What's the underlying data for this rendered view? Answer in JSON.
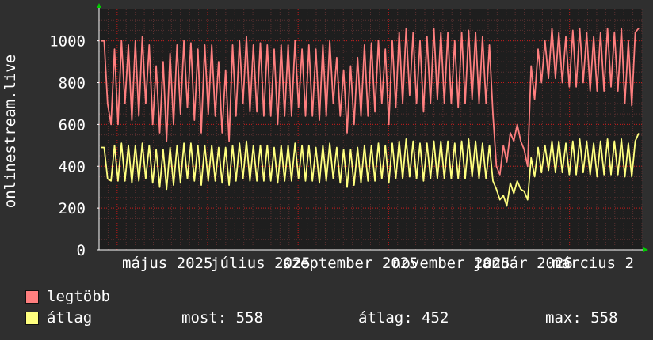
{
  "chart_data": {
    "type": "line",
    "ylabel": "onlinestream.live",
    "ylim": [
      0,
      1150
    ],
    "yticks": [
      0,
      200,
      400,
      600,
      800,
      1000
    ],
    "xtick_labels": [
      "május 2025",
      "július 2025",
      "szeptember 2025",
      "november 2025",
      "január 2026",
      "március 2"
    ],
    "grid": true,
    "series": [
      {
        "name": "legtöbb",
        "color": "#ff7f7f",
        "values": [
          1000,
          1000,
          700,
          600,
          960,
          600,
          1000,
          700,
          980,
          620,
          1000,
          640,
          1020,
          700,
          980,
          600,
          880,
          560,
          900,
          520,
          940,
          600,
          980,
          650,
          1000,
          680,
          990,
          620,
          960,
          560,
          980,
          650,
          980,
          640,
          900,
          560,
          860,
          520,
          980,
          640,
          1000,
          700,
          1020,
          660,
          980,
          660,
          990,
          640,
          980,
          640,
          960,
          600,
          980,
          640,
          980,
          640,
          1000,
          680,
          960,
          640,
          980,
          640,
          960,
          620,
          980,
          640,
          1000,
          700,
          920,
          640,
          860,
          560,
          880,
          600,
          920,
          640,
          980,
          640,
          990,
          660,
          1000,
          700,
          960,
          600,
          1000,
          680,
          1040,
          700,
          1060,
          740,
          1040,
          700,
          1000,
          660,
          1020,
          700,
          1060,
          720,
          1040,
          700,
          1040,
          700,
          1000,
          680,
          1040,
          700,
          1050,
          720,
          1040,
          700,
          1020,
          700,
          980,
          650,
          400,
          360,
          500,
          420,
          560,
          520,
          600,
          520,
          480,
          400,
          880,
          720,
          960,
          800,
          1000,
          820,
          1060,
          820,
          1040,
          800,
          1020,
          780,
          1050,
          780,
          1060,
          800,
          1040,
          760,
          1020,
          760,
          1040,
          760,
          1060,
          780,
          1040,
          760,
          1060,
          700,
          1000,
          690,
          1040,
          1060
        ]
      },
      {
        "name": "átlag",
        "color": "#ffff7f",
        "values": [
          490,
          490,
          340,
          330,
          500,
          330,
          510,
          330,
          500,
          320,
          500,
          330,
          510,
          340,
          500,
          320,
          480,
          300,
          480,
          290,
          490,
          310,
          500,
          320,
          510,
          340,
          510,
          330,
          500,
          310,
          500,
          330,
          500,
          330,
          490,
          320,
          490,
          310,
          500,
          330,
          510,
          340,
          520,
          330,
          500,
          330,
          500,
          330,
          500,
          330,
          490,
          320,
          500,
          330,
          500,
          330,
          510,
          340,
          500,
          330,
          500,
          330,
          490,
          320,
          500,
          330,
          510,
          340,
          490,
          320,
          480,
          300,
          480,
          310,
          490,
          320,
          500,
          330,
          500,
          330,
          510,
          340,
          500,
          320,
          510,
          340,
          520,
          340,
          530,
          350,
          520,
          340,
          510,
          330,
          510,
          340,
          520,
          340,
          520,
          340,
          520,
          340,
          510,
          340,
          520,
          340,
          530,
          350,
          520,
          340,
          510,
          340,
          500,
          330,
          290,
          240,
          260,
          210,
          320,
          270,
          330,
          290,
          280,
          240,
          440,
          350,
          490,
          370,
          500,
          380,
          520,
          370,
          520,
          370,
          510,
          360,
          520,
          360,
          530,
          370,
          520,
          360,
          510,
          350,
          520,
          360,
          530,
          360,
          520,
          360,
          530,
          350,
          510,
          350,
          520,
          558
        ]
      }
    ],
    "stats": [
      {
        "label": "most:",
        "value": "558"
      },
      {
        "label": "átlag:",
        "value": "452"
      },
      {
        "label": "max:",
        "value": "558"
      }
    ]
  },
  "colors": {
    "background": "#2f2f2f",
    "plot_background": "#1e1e1e",
    "grid": "#c41a1a",
    "axis": "#ffffff",
    "arrow": "#00cc00"
  }
}
